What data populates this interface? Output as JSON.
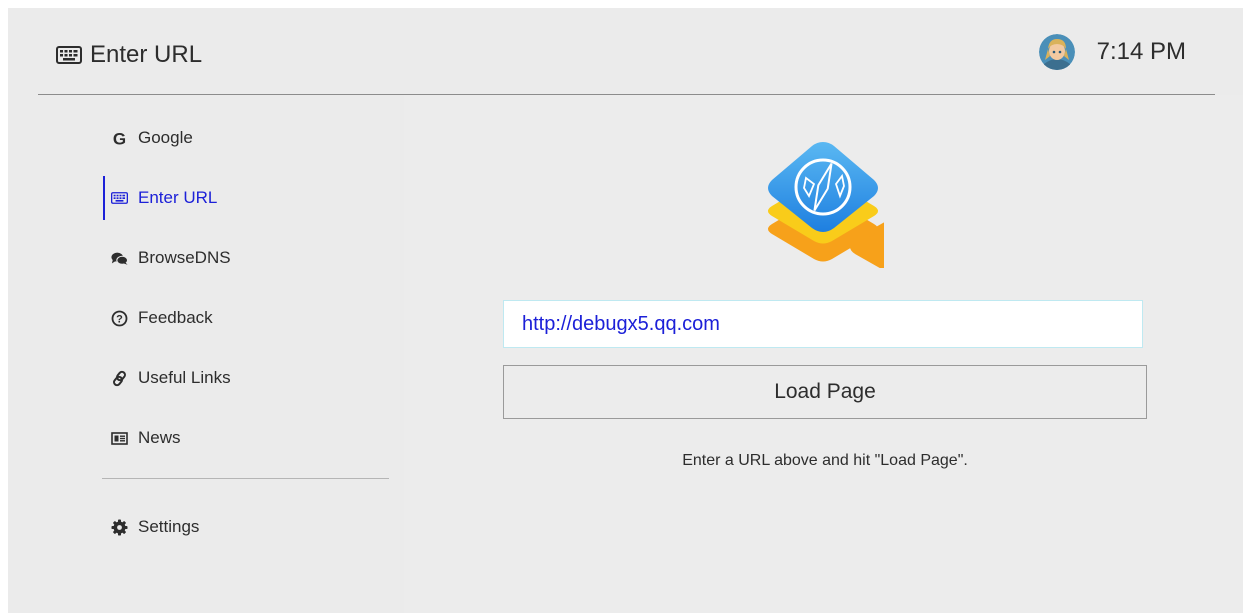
{
  "header": {
    "title": "Enter URL",
    "title_icon": "keyboard-icon",
    "avatar_icon": "avatar-icon",
    "time": "7:14 PM"
  },
  "sidebar": {
    "items": [
      {
        "label": "Google",
        "icon": "google-icon",
        "active": false
      },
      {
        "label": "Enter URL",
        "icon": "keyboard-icon",
        "active": true
      },
      {
        "label": "BrowseDNS",
        "icon": "chat-bubbles-icon",
        "active": false
      },
      {
        "label": "Feedback",
        "icon": "question-circle-icon",
        "active": false
      },
      {
        "label": "Useful Links",
        "icon": "link-icon",
        "active": false
      },
      {
        "label": "News",
        "icon": "newspaper-icon",
        "active": false
      },
      {
        "label": "Settings",
        "icon": "gear-icon",
        "active": false
      }
    ]
  },
  "main": {
    "logo_icon": "compass-app-icon",
    "url_value": "http://debugx5.qq.com",
    "load_label": "Load Page",
    "hint": "Enter a URL above and hit \"Load Page\"."
  },
  "colors": {
    "accent": "#1c20d8",
    "background": "#ebebeb",
    "input_border": "#bfe9f1",
    "logo_blue": "#2f8fe6",
    "logo_yellow": "#f9cc1a",
    "logo_orange": "#f7a11a"
  }
}
